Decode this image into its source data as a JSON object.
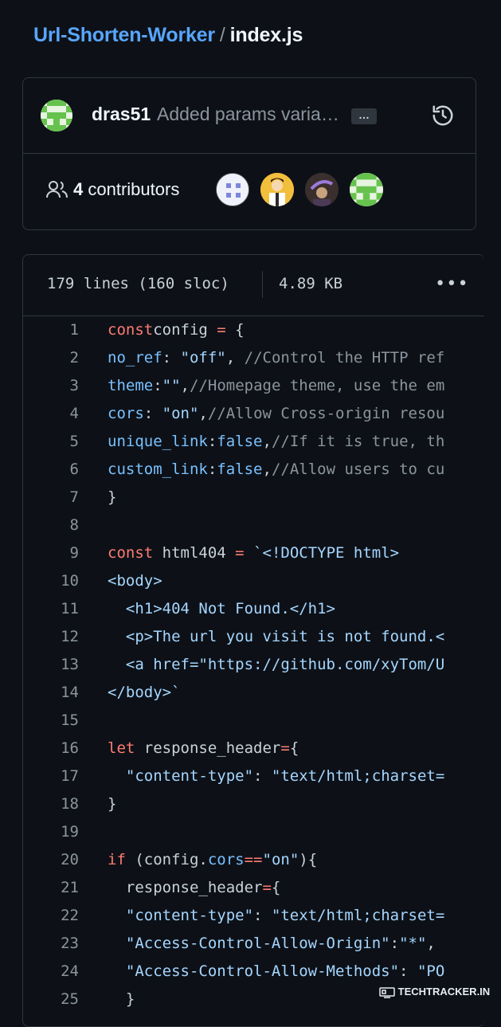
{
  "breadcrumb": {
    "repo": "Url-Shorten-Worker",
    "separator": "/",
    "file": "index.js"
  },
  "commit": {
    "author": "dras51",
    "message": "Added params varia…",
    "more_label": "…"
  },
  "contributors": {
    "count": "4",
    "label": "contributors"
  },
  "file_info": {
    "lines": "179 lines (160 sloc)",
    "size": "4.89 KB"
  },
  "code": [
    {
      "n": "1",
      "tokens": [
        [
          "k",
          "const"
        ],
        [
          "",
          "config "
        ],
        [
          "k",
          "="
        ],
        [
          "",
          " {"
        ]
      ]
    },
    {
      "n": "2",
      "tokens": [
        [
          "p",
          "no_ref"
        ],
        [
          "",
          ": "
        ],
        [
          "s",
          "\"off\""
        ],
        [
          "",
          ", "
        ],
        [
          "c",
          "//Control the HTTP ref"
        ]
      ]
    },
    {
      "n": "3",
      "tokens": [
        [
          "p",
          "theme"
        ],
        [
          "",
          ":"
        ],
        [
          "s",
          "\"\""
        ],
        [
          "",
          ","
        ],
        [
          "c",
          "//Homepage theme, use the em"
        ]
      ]
    },
    {
      "n": "4",
      "tokens": [
        [
          "p",
          "cors"
        ],
        [
          "",
          ": "
        ],
        [
          "s",
          "\"on\""
        ],
        [
          "",
          ","
        ],
        [
          "c",
          "//Allow Cross-origin resou"
        ]
      ]
    },
    {
      "n": "5",
      "tokens": [
        [
          "p",
          "unique_link"
        ],
        [
          "",
          ":"
        ],
        [
          "p",
          "false"
        ],
        [
          "",
          ","
        ],
        [
          "c",
          "//If it is true, th"
        ]
      ]
    },
    {
      "n": "6",
      "tokens": [
        [
          "p",
          "custom_link"
        ],
        [
          "",
          ":"
        ],
        [
          "p",
          "false"
        ],
        [
          "",
          ","
        ],
        [
          "c",
          "//Allow users to cu"
        ]
      ]
    },
    {
      "n": "7",
      "tokens": [
        [
          "",
          "}"
        ]
      ]
    },
    {
      "n": "8",
      "tokens": []
    },
    {
      "n": "9",
      "tokens": [
        [
          "k",
          "const"
        ],
        [
          "",
          " html404 "
        ],
        [
          "k",
          "="
        ],
        [
          "",
          " "
        ],
        [
          "s",
          "`<!DOCTYPE html>"
        ]
      ]
    },
    {
      "n": "10",
      "tokens": [
        [
          "s",
          "<body>"
        ]
      ]
    },
    {
      "n": "11",
      "tokens": [
        [
          "s",
          "  <h1>404 Not Found.</h1>"
        ]
      ]
    },
    {
      "n": "12",
      "tokens": [
        [
          "s",
          "  <p>The url you visit is not found.<"
        ]
      ]
    },
    {
      "n": "13",
      "tokens": [
        [
          "s",
          "  <a href=\"https://github.com/xyTom/U"
        ]
      ]
    },
    {
      "n": "14",
      "tokens": [
        [
          "s",
          "</body>`"
        ]
      ]
    },
    {
      "n": "15",
      "tokens": []
    },
    {
      "n": "16",
      "tokens": [
        [
          "k",
          "let"
        ],
        [
          "",
          " response_header"
        ],
        [
          "k",
          "="
        ],
        [
          "",
          "{"
        ]
      ]
    },
    {
      "n": "17",
      "tokens": [
        [
          "",
          ""
        ],
        [
          "s",
          "  \"content-type\""
        ],
        [
          "",
          ": "
        ],
        [
          "s",
          "\"text/html;charset="
        ]
      ]
    },
    {
      "n": "18",
      "tokens": [
        [
          "",
          "}"
        ]
      ]
    },
    {
      "n": "19",
      "tokens": []
    },
    {
      "n": "20",
      "tokens": [
        [
          "k",
          "if"
        ],
        [
          "",
          " (config."
        ],
        [
          "p",
          "cors"
        ],
        [
          "k",
          "=="
        ],
        [
          "s",
          "\"on\""
        ],
        [
          "",
          "){"
        ]
      ]
    },
    {
      "n": "21",
      "tokens": [
        [
          "",
          "  response_header"
        ],
        [
          "k",
          "="
        ],
        [
          "",
          "{"
        ]
      ]
    },
    {
      "n": "22",
      "tokens": [
        [
          "s",
          "  \"content-type\""
        ],
        [
          "",
          ": "
        ],
        [
          "s",
          "\"text/html;charset="
        ]
      ]
    },
    {
      "n": "23",
      "tokens": [
        [
          "s",
          "  \"Access-Control-Allow-Origin\""
        ],
        [
          "",
          ":"
        ],
        [
          "s",
          "\"*\""
        ],
        [
          "",
          ","
        ]
      ]
    },
    {
      "n": "24",
      "tokens": [
        [
          "s",
          "  \"Access-Control-Allow-Methods\""
        ],
        [
          "",
          ": "
        ],
        [
          "s",
          "\"PO"
        ]
      ]
    },
    {
      "n": "25",
      "tokens": [
        [
          "",
          "  }"
        ]
      ]
    }
  ],
  "watermark": "TECHTRACKER.IN"
}
